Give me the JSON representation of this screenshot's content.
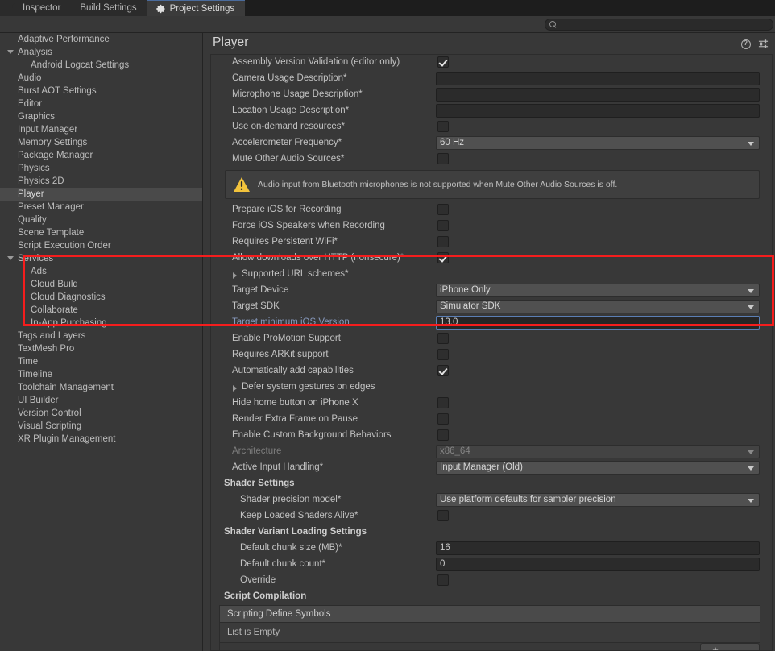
{
  "tabs": [
    {
      "label": "Inspector",
      "icon": "info-icon",
      "active": false
    },
    {
      "label": "Build Settings",
      "icon": "none",
      "active": false
    },
    {
      "label": "Project Settings",
      "icon": "gear-icon",
      "active": true
    }
  ],
  "search": {
    "value": "",
    "placeholder": "",
    "icon": "search-icon"
  },
  "sidebar": {
    "items": [
      {
        "label": "Adaptive Performance",
        "depth": 0,
        "arrow": false,
        "selected": false
      },
      {
        "label": "Analysis",
        "depth": 0,
        "arrow": true,
        "selected": false
      },
      {
        "label": "Android Logcat Settings",
        "depth": 1,
        "arrow": false,
        "selected": false
      },
      {
        "label": "Audio",
        "depth": 0,
        "arrow": false,
        "selected": false
      },
      {
        "label": "Burst AOT Settings",
        "depth": 0,
        "arrow": false,
        "selected": false
      },
      {
        "label": "Editor",
        "depth": 0,
        "arrow": false,
        "selected": false
      },
      {
        "label": "Graphics",
        "depth": 0,
        "arrow": false,
        "selected": false
      },
      {
        "label": "Input Manager",
        "depth": 0,
        "arrow": false,
        "selected": false
      },
      {
        "label": "Memory Settings",
        "depth": 0,
        "arrow": false,
        "selected": false
      },
      {
        "label": "Package Manager",
        "depth": 0,
        "arrow": false,
        "selected": false
      },
      {
        "label": "Physics",
        "depth": 0,
        "arrow": false,
        "selected": false
      },
      {
        "label": "Physics 2D",
        "depth": 0,
        "arrow": false,
        "selected": false
      },
      {
        "label": "Player",
        "depth": 0,
        "arrow": false,
        "selected": true
      },
      {
        "label": "Preset Manager",
        "depth": 0,
        "arrow": false,
        "selected": false
      },
      {
        "label": "Quality",
        "depth": 0,
        "arrow": false,
        "selected": false
      },
      {
        "label": "Scene Template",
        "depth": 0,
        "arrow": false,
        "selected": false
      },
      {
        "label": "Script Execution Order",
        "depth": 0,
        "arrow": false,
        "selected": false
      },
      {
        "label": "Services",
        "depth": 0,
        "arrow": true,
        "selected": false
      },
      {
        "label": "Ads",
        "depth": 1,
        "arrow": false,
        "selected": false
      },
      {
        "label": "Cloud Build",
        "depth": 1,
        "arrow": false,
        "selected": false
      },
      {
        "label": "Cloud Diagnostics",
        "depth": 1,
        "arrow": false,
        "selected": false
      },
      {
        "label": "Collaborate",
        "depth": 1,
        "arrow": false,
        "selected": false
      },
      {
        "label": "In-App Purchasing",
        "depth": 1,
        "arrow": false,
        "selected": false
      },
      {
        "label": "Tags and Layers",
        "depth": 0,
        "arrow": false,
        "selected": false
      },
      {
        "label": "TextMesh Pro",
        "depth": 0,
        "arrow": false,
        "selected": false
      },
      {
        "label": "Time",
        "depth": 0,
        "arrow": false,
        "selected": false
      },
      {
        "label": "Timeline",
        "depth": 0,
        "arrow": false,
        "selected": false
      },
      {
        "label": "Toolchain Management",
        "depth": 0,
        "arrow": false,
        "selected": false
      },
      {
        "label": "UI Builder",
        "depth": 0,
        "arrow": false,
        "selected": false
      },
      {
        "label": "Version Control",
        "depth": 0,
        "arrow": false,
        "selected": false
      },
      {
        "label": "Visual Scripting",
        "depth": 0,
        "arrow": false,
        "selected": false
      },
      {
        "label": "XR Plugin Management",
        "depth": 0,
        "arrow": false,
        "selected": false
      }
    ]
  },
  "header": {
    "title": "Player",
    "help_icon": "help-icon",
    "preset_icon": "preset-settings-icon"
  },
  "rows": {
    "assembly_version_validation": {
      "label": "Assembly Version Validation (editor only)",
      "checked": true
    },
    "camera_usage": {
      "label": "Camera Usage Description*",
      "value": ""
    },
    "microphone_usage": {
      "label": "Microphone Usage Description*",
      "value": ""
    },
    "location_usage": {
      "label": "Location Usage Description*",
      "value": ""
    },
    "on_demand_resources": {
      "label": "Use on-demand resources*",
      "checked": false
    },
    "accelerometer_frequency": {
      "label": "Accelerometer Frequency*",
      "value": "60 Hz"
    },
    "mute_other_audio": {
      "label": "Mute Other Audio Sources*",
      "checked": false
    },
    "warning": {
      "icon": "warning-icon",
      "text": "Audio input from Bluetooth microphones is not supported when Mute Other Audio Sources is off."
    },
    "prepare_ios_recording": {
      "label": "Prepare iOS for Recording",
      "checked": false
    },
    "force_ios_speakers": {
      "label": "Force iOS Speakers when Recording",
      "checked": false
    },
    "requires_persistent_wifi": {
      "label": "Requires Persistent WiFi*",
      "checked": false
    },
    "allow_http_downloads": {
      "label": "Allow downloads over HTTP (nonsecure)*",
      "checked": true
    },
    "supported_url_schemes": {
      "label": "Supported URL schemes*",
      "expanded": false
    },
    "target_device": {
      "label": "Target Device",
      "value": "iPhone Only"
    },
    "target_sdk": {
      "label": "Target SDK",
      "value": "Simulator SDK"
    },
    "target_min_ios": {
      "label": "Target minimum iOS Version",
      "value": "13.0"
    },
    "enable_promotion": {
      "label": "Enable ProMotion Support",
      "checked": false
    },
    "requires_arkit": {
      "label": "Requires ARKit support",
      "checked": false
    },
    "auto_add_capabilities": {
      "label": "Automatically add capabilities",
      "checked": true
    },
    "defer_system_gestures": {
      "label": "Defer system gestures on edges",
      "expanded": false
    },
    "hide_home_button": {
      "label": "Hide home button on iPhone X",
      "checked": false
    },
    "render_extra_frame": {
      "label": "Render Extra Frame on Pause",
      "checked": false
    },
    "custom_background": {
      "label": "Enable Custom Background Behaviors",
      "checked": false
    },
    "architecture": {
      "label": "Architecture",
      "value": "x86_64",
      "disabled": true
    },
    "active_input_handling": {
      "label": "Active Input Handling*",
      "value": "Input Manager (Old)"
    },
    "shader_settings_header": {
      "label": "Shader Settings"
    },
    "shader_precision_model": {
      "label": "Shader precision model*",
      "value": "Use platform defaults for sampler precision"
    },
    "keep_loaded_shaders": {
      "label": "Keep Loaded Shaders Alive*",
      "checked": false
    },
    "shader_variant_header": {
      "label": "Shader Variant Loading Settings"
    },
    "default_chunk_size": {
      "label": "Default chunk size (MB)*",
      "value": "16"
    },
    "default_chunk_count": {
      "label": "Default chunk count*",
      "value": "0"
    },
    "override": {
      "label": "Override",
      "checked": false
    },
    "script_compilation_header": {
      "label": "Script Compilation"
    },
    "scripting_define_symbols": {
      "header": "Scripting Define Symbols",
      "empty_text": "List is Empty",
      "add_label": "+",
      "remove_label": "–"
    }
  },
  "colors": {
    "highlight_box": "#f51d1d",
    "override_label": "#8799bd",
    "warning": "#f2c33c",
    "selection": "#4a4a4a"
  }
}
